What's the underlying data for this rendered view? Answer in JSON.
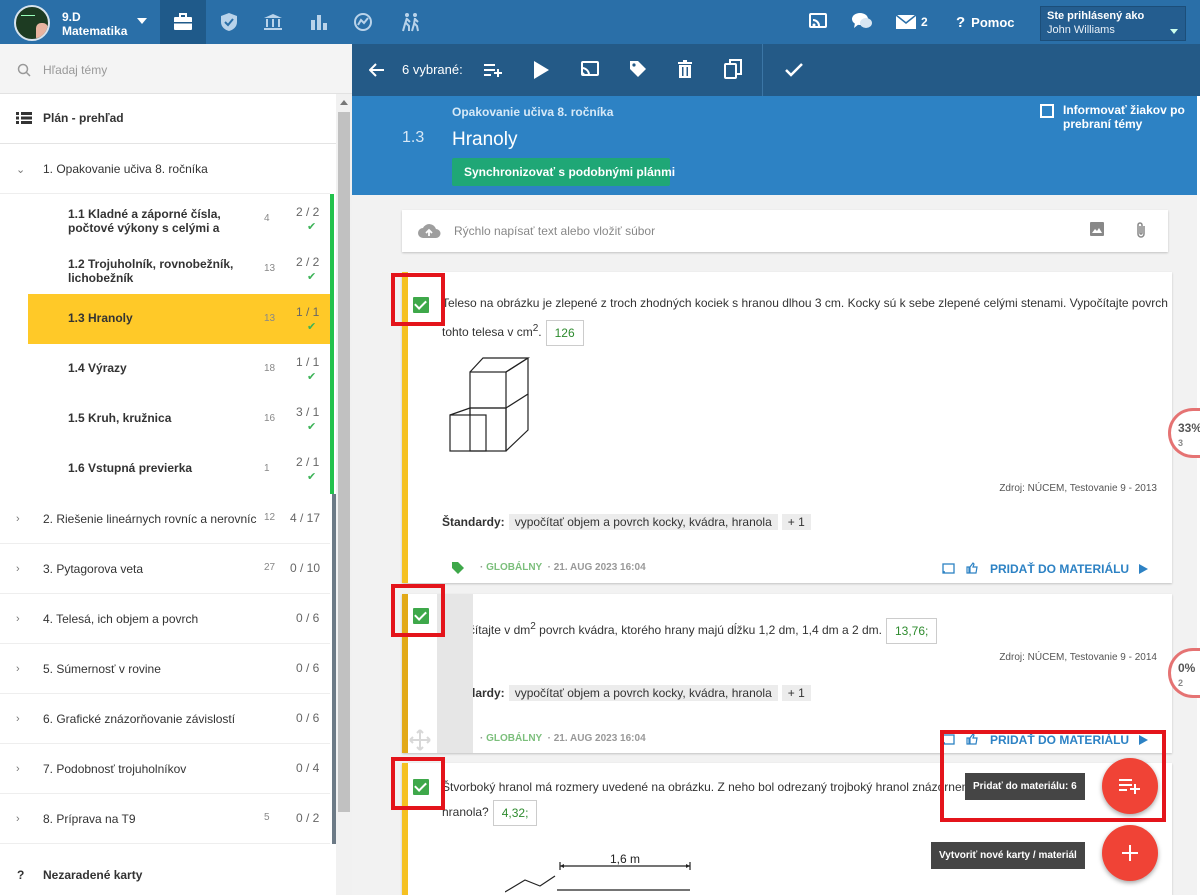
{
  "header": {
    "class_name": "9.D",
    "subject": "Matematika",
    "messages_count": "2",
    "help_label": "Pomoc",
    "logged_in_label": "Ste prihlásený ako",
    "user_name": "John Williams"
  },
  "sidebar": {
    "search_placeholder": "Hľadaj témy",
    "plan_label": "Plán - prehľad",
    "chapter1": {
      "label": "1. Opakovanie učiva 8. ročníka"
    },
    "subtopics": [
      {
        "label": "1.1  Kladné a záporné čísla, počtové výkony s celými a",
        "count": "4",
        "fraction": "2 / 2"
      },
      {
        "label": "1.2  Trojuholník, rovnobežník, lichobežník",
        "count": "13",
        "fraction": "2 / 2"
      },
      {
        "label": "1.3  Hranoly",
        "count": "13",
        "fraction": "1 / 1"
      },
      {
        "label": "1.4  Výrazy",
        "count": "18",
        "fraction": "1 / 1"
      },
      {
        "label": "1.5  Kruh, kružnica",
        "count": "16",
        "fraction": "3 / 1"
      },
      {
        "label": "1.6  Vstupná previerka",
        "count": "1",
        "fraction": "2 / 1"
      }
    ],
    "chapters": [
      {
        "label": "2. Riešenie lineárnych rovníc a nerovníc",
        "count": "12",
        "fraction": "4 / 17"
      },
      {
        "label": "3. Pytagorova veta",
        "count": "27",
        "fraction": "0 / 10"
      },
      {
        "label": "4. Telesá, ich objem a povrch",
        "count": "",
        "fraction": "0 / 6"
      },
      {
        "label": "5. Súmernosť v rovine",
        "count": "",
        "fraction": "0 / 6"
      },
      {
        "label": "6. Grafické znázorňovanie závislostí",
        "count": "",
        "fraction": "0 / 6"
      },
      {
        "label": "7. Podobnosť trojuholníkov",
        "count": "",
        "fraction": "0 / 4"
      },
      {
        "label": "8. Príprava na T9",
        "count": "5",
        "fraction": "0 / 2"
      }
    ],
    "unassigned_label": "Nezaradené karty"
  },
  "toolbar": {
    "selected_label": "6 vybrané:"
  },
  "topic": {
    "number": "1.3",
    "parent": "Opakovanie učiva 8. ročníka",
    "title": "Hranoly",
    "sync_button": "Synchronizovať s podobnými plánmi",
    "inform_label": "Informovať žiakov po prebraní témy"
  },
  "quick_input": {
    "placeholder": "Rýchlo napísať text alebo vložiť súbor"
  },
  "cards": [
    {
      "text_a": "Teleso na obrázku je zlepené z troch zhodných kociek s hranou dlhou 3 cm. Kocky sú k sebe zlepené celými stenami. Vypočítajte povrch tohto telesa v cm",
      "sup": "2",
      "text_b": ".",
      "answer": "126",
      "source": "Zdroj: NÚCEM, Testovanie 9 - 2013",
      "standards_label": "Štandardy:",
      "standard": "vypočítať objem a povrch kocky, kvádra, hranola",
      "more": "+ 1",
      "scope": "GLOBÁLNY",
      "date": "21. AUG 2023 16:04",
      "add_label": "PRIDAŤ DO MATERIÁLU"
    },
    {
      "text_a": "Vypočítajte v dm",
      "sup": "2",
      "text_b": " povrch kvádra, ktorého hrany majú dĺžku 1,2 dm, 1,4 dm a 2 dm.",
      "answer": "13,76;",
      "source": "Zdroj: NÚCEM, Testovanie 9 - 2014",
      "standards_label": "Štandardy:",
      "standard": "vypočítať objem a povrch kocky, kvádra, hranola",
      "more": "+ 1",
      "scope": "GLOBÁLNY",
      "date": "21. AUG 2023 16:04",
      "add_label": "PRIDAŤ DO MATERIÁLU"
    },
    {
      "text_a": "Štvorboký hranol má rozmery uvedené na obrázku. Z neho bol odrezaný trojboký hranol znázornený",
      "text_b": "zvyšná časť hranola?",
      "answer": "4,32;",
      "figure_label": "1,6 m"
    }
  ],
  "side_progress": [
    {
      "value": "33%",
      "sub": "3"
    },
    {
      "value": "0%",
      "sub": "2"
    }
  ],
  "fab": {
    "add_tooltip": "Pridať do materiálu: 6",
    "create_tooltip": "Vytvoriť nové karty / materiál"
  },
  "colors": {
    "topbar": "#2a6fa8",
    "toolbar": "#245a87",
    "topic_header": "#2d82c4",
    "selected_topic": "#ffc928",
    "accent_green": "#22c24c",
    "fab_red": "#f04336",
    "highlight_red": "#e4141b"
  }
}
